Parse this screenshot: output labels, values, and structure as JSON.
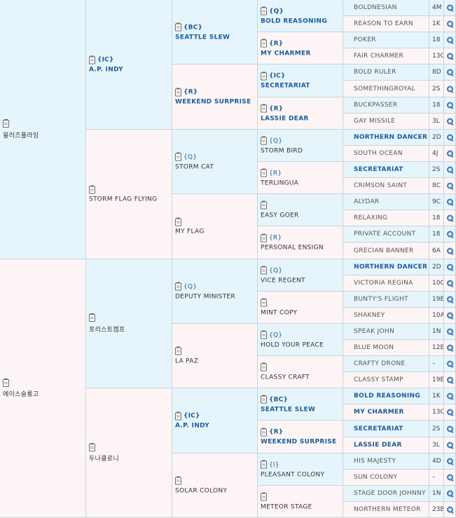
{
  "pedigree": {
    "gen1": [
      {
        "name": "윌러즈플라잉",
        "tag": "",
        "bold": false,
        "shade": "blue"
      },
      {
        "name": "에이스슬롱고",
        "tag": "",
        "bold": false,
        "shade": "pink"
      }
    ],
    "gen2": [
      {
        "name": "A.P. INDY",
        "tag": "{IC}",
        "bold": true,
        "shade": "blue"
      },
      {
        "name": "STORM FLAG FLYING",
        "tag": "",
        "bold": false,
        "shade": "pink"
      },
      {
        "name": "포리스트캠프",
        "tag": "",
        "bold": false,
        "shade": "blue"
      },
      {
        "name": "두나클로니",
        "tag": "",
        "bold": false,
        "shade": "pink"
      }
    ],
    "gen3": [
      {
        "name": "SEATTLE SLEW",
        "tag": "{BC}",
        "bold": true,
        "shade": "blue"
      },
      {
        "name": "WEEKEND SURPRISE",
        "tag": "{R}",
        "bold": true,
        "shade": "pink"
      },
      {
        "name": "STORM CAT",
        "tag": "{Q}",
        "bold": false,
        "shade": "blue"
      },
      {
        "name": "MY FLAG",
        "tag": "",
        "bold": false,
        "shade": "pink"
      },
      {
        "name": "DEPUTY MINISTER",
        "tag": "{Q}",
        "bold": false,
        "shade": "blue"
      },
      {
        "name": "LA PAZ",
        "tag": "",
        "bold": false,
        "shade": "pink"
      },
      {
        "name": "A.P. INDY",
        "tag": "{IC}",
        "bold": true,
        "shade": "blue"
      },
      {
        "name": "SOLAR COLONY",
        "tag": "",
        "bold": false,
        "shade": "pink"
      }
    ],
    "gen4": [
      {
        "name": "BOLD REASONING",
        "tag": "{Q}",
        "bold": true,
        "shade": "blue"
      },
      {
        "name": "MY CHARMER",
        "tag": "{R}",
        "bold": true,
        "shade": "pink"
      },
      {
        "name": "SECRETARIAT",
        "tag": "{IC}",
        "bold": true,
        "shade": "blue"
      },
      {
        "name": "LASSIE DEAR",
        "tag": "{R}",
        "bold": true,
        "shade": "pink"
      },
      {
        "name": "STORM BIRD",
        "tag": "{Q}",
        "bold": false,
        "shade": "blue"
      },
      {
        "name": "TERLINGUA",
        "tag": "{R}",
        "bold": false,
        "shade": "pink"
      },
      {
        "name": "EASY GOER",
        "tag": "",
        "bold": false,
        "shade": "blue"
      },
      {
        "name": "PERSONAL ENSIGN",
        "tag": "{R}",
        "bold": false,
        "shade": "pink"
      },
      {
        "name": "VICE REGENT",
        "tag": "{Q}",
        "bold": false,
        "shade": "blue"
      },
      {
        "name": "MINT COPY",
        "tag": "",
        "bold": false,
        "shade": "pink"
      },
      {
        "name": "HOLD YOUR PEACE",
        "tag": "{Q}",
        "bold": false,
        "shade": "blue"
      },
      {
        "name": "CLASSY CRAFT",
        "tag": "",
        "bold": false,
        "shade": "pink"
      },
      {
        "name": "SEATTLE SLEW",
        "tag": "{BC}",
        "bold": true,
        "shade": "blue"
      },
      {
        "name": "WEEKEND SURPRISE",
        "tag": "{R}",
        "bold": true,
        "shade": "pink"
      },
      {
        "name": "PLEASANT COLONY",
        "tag": "{I}",
        "bold": false,
        "shade": "blue"
      },
      {
        "name": "METEOR STAGE",
        "tag": "",
        "bold": false,
        "shade": "pink"
      }
    ],
    "gen5": [
      {
        "name": "BOLDNESIAN",
        "bold": false,
        "code": "4M"
      },
      {
        "name": "REASON TO EARN",
        "bold": false,
        "code": "1K"
      },
      {
        "name": "POKER",
        "bold": false,
        "code": "18"
      },
      {
        "name": "FAIR CHARMER",
        "bold": false,
        "code": "13C"
      },
      {
        "name": "BOLD RULER",
        "bold": false,
        "code": "8D"
      },
      {
        "name": "SOMETHINGROYAL",
        "bold": false,
        "code": "2S"
      },
      {
        "name": "BUCKPASSER",
        "bold": false,
        "code": "18"
      },
      {
        "name": "GAY MISSILE",
        "bold": false,
        "code": "3L"
      },
      {
        "name": "NORTHERN DANCER",
        "bold": true,
        "code": "2D"
      },
      {
        "name": "SOUTH OCEAN",
        "bold": false,
        "code": "4J"
      },
      {
        "name": "SECRETARIAT",
        "bold": true,
        "code": "2S"
      },
      {
        "name": "CRIMSON SAINT",
        "bold": false,
        "code": "8C"
      },
      {
        "name": "ALYDAR",
        "bold": false,
        "code": "9C"
      },
      {
        "name": "RELAXING",
        "bold": false,
        "code": "18"
      },
      {
        "name": "PRIVATE ACCOUNT",
        "bold": false,
        "code": "18"
      },
      {
        "name": "GRECIAN BANNER",
        "bold": false,
        "code": "6A"
      },
      {
        "name": "NORTHERN DANCER",
        "bold": true,
        "code": "2D"
      },
      {
        "name": "VICTORIA REGINA",
        "bold": false,
        "code": "10C"
      },
      {
        "name": "BUNTY'S FLIGHT",
        "bold": false,
        "code": "19E"
      },
      {
        "name": "SHAKNEY",
        "bold": false,
        "code": "10A"
      },
      {
        "name": "SPEAK JOHN",
        "bold": false,
        "code": "1N"
      },
      {
        "name": "BLUE MOON",
        "bold": false,
        "code": "12E"
      },
      {
        "name": "CRAFTY DRONE",
        "bold": false,
        "code": "–"
      },
      {
        "name": "CLASSY STAMP",
        "bold": false,
        "code": "19E"
      },
      {
        "name": "BOLD REASONING",
        "bold": true,
        "code": "1K"
      },
      {
        "name": "MY CHARMER",
        "bold": true,
        "code": "13C"
      },
      {
        "name": "SECRETARIAT",
        "bold": true,
        "code": "2S"
      },
      {
        "name": "LASSIE DEAR",
        "bold": true,
        "code": "3L"
      },
      {
        "name": "HIS MAJESTY",
        "bold": false,
        "code": "4D"
      },
      {
        "name": "SUN COLONY",
        "bold": false,
        "code": "–"
      },
      {
        "name": "STAGE DOOR JOHNNY",
        "bold": false,
        "code": "1N"
      },
      {
        "name": "NORTHERN METEOR",
        "bold": false,
        "code": "23B"
      }
    ]
  },
  "icons": {
    "cell_marker": "clipboard-icon",
    "detail_link": "magnifier-icon"
  },
  "colors": {
    "sire_row": "#e6f5fc",
    "dam_row": "#fdf5f5",
    "link": "#1a5c99",
    "border": "#c9d3dd"
  }
}
